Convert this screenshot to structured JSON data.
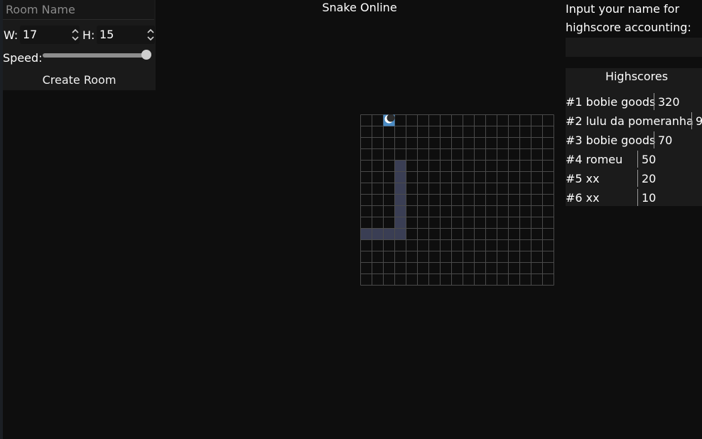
{
  "room_panel": {
    "room_name_placeholder": "Room Name",
    "width_label": "W:",
    "width_value": "17",
    "height_label": "H:",
    "height_value": "15",
    "speed_label": "Speed:",
    "speed_level": 1.0,
    "create_button": "Create Room"
  },
  "title": "Snake Online",
  "board": {
    "columns": 17,
    "rows": 15,
    "grid_color": "#4a4a4a",
    "snake_color": "#3a3e54",
    "head_color": "#4a8bc4",
    "head": [
      2,
      0
    ],
    "snake": [
      [
        3,
        4
      ],
      [
        3,
        5
      ],
      [
        3,
        6
      ],
      [
        3,
        7
      ],
      [
        3,
        8
      ],
      [
        3,
        9
      ],
      [
        3,
        10
      ],
      [
        2,
        10
      ],
      [
        1,
        10
      ],
      [
        0,
        10
      ]
    ]
  },
  "right_panel": {
    "prompt": "Input your name for highscore accounting:",
    "name_value": "",
    "highscores_title": "Highscores",
    "scores": [
      {
        "label": "#1 bobie goods",
        "score": "320"
      },
      {
        "label": "#2 lulu da pomeranha",
        "score": "9"
      },
      {
        "label": "#3 bobie goods",
        "score": "70"
      },
      {
        "label": "#4 romeu",
        "score": "50"
      },
      {
        "label": "#5 xx",
        "score": "20"
      },
      {
        "label": "#6 xx",
        "score": "10"
      }
    ]
  }
}
